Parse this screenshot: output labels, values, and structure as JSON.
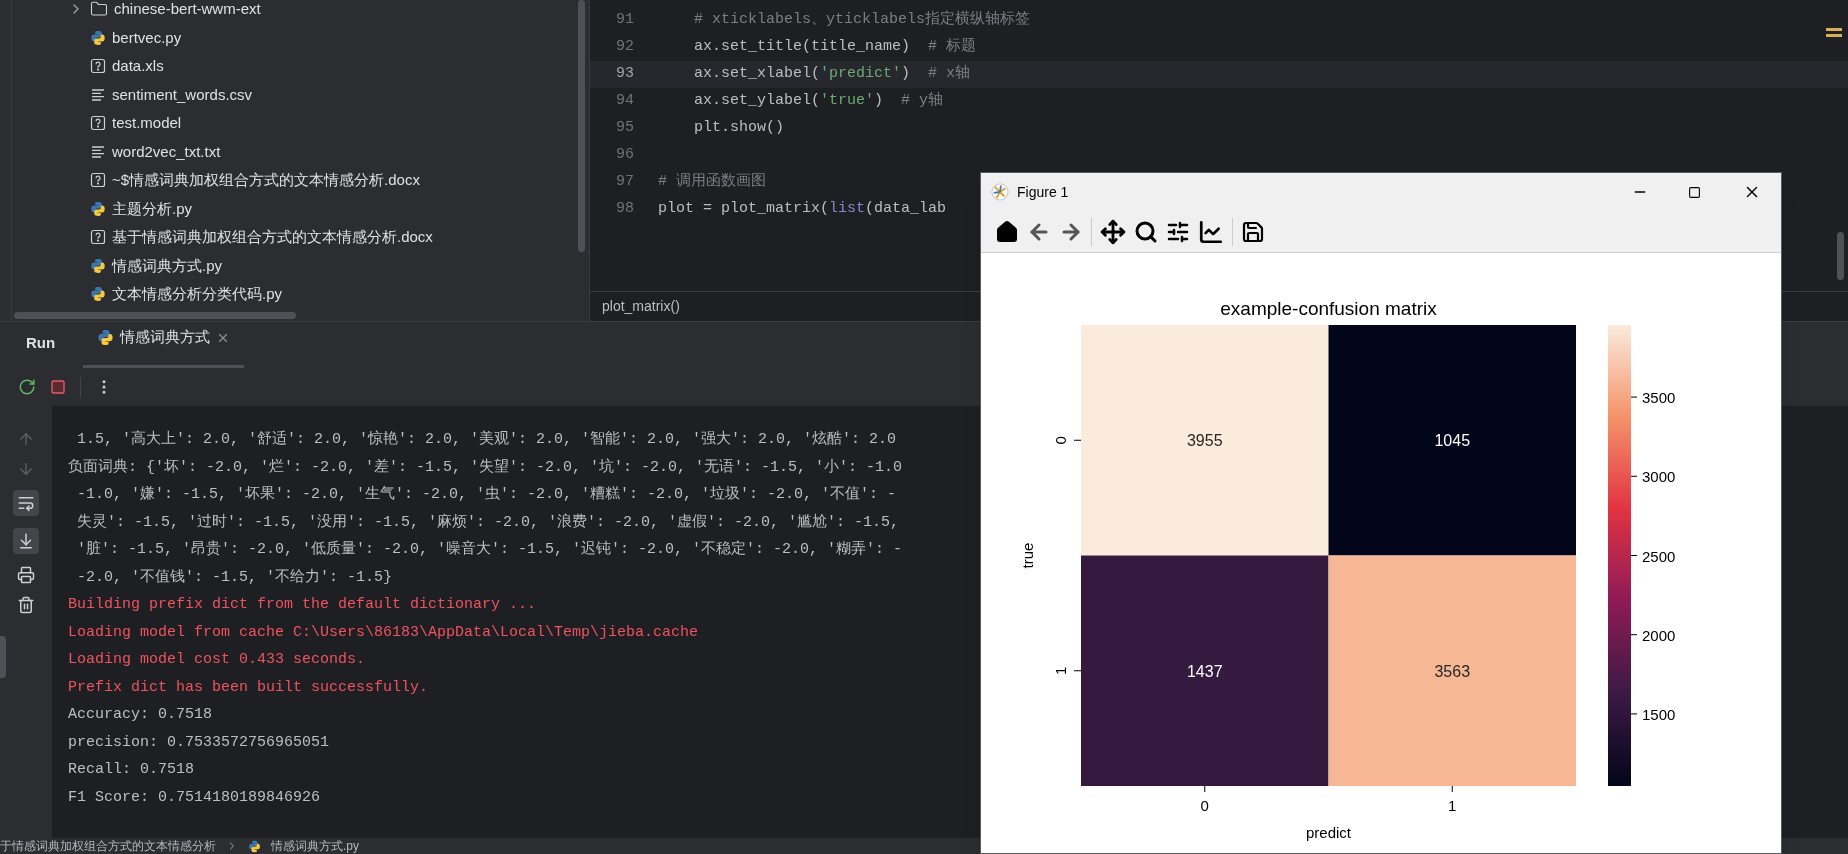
{
  "project_tree": {
    "items": [
      {
        "label": "chinese-bert-wwm-ext",
        "kind": "folder"
      },
      {
        "label": "bertvec.py",
        "kind": "python"
      },
      {
        "label": "data.xls",
        "kind": "unknown"
      },
      {
        "label": "sentiment_words.csv",
        "kind": "text"
      },
      {
        "label": "test.model",
        "kind": "unknown"
      },
      {
        "label": "word2vec_txt.txt",
        "kind": "text"
      },
      {
        "label": "~$情感词典加权组合方式的文本情感分析.docx",
        "kind": "unknown"
      },
      {
        "label": "主题分析.py",
        "kind": "python"
      },
      {
        "label": "基于情感词典加权组合方式的文本情感分析.docx",
        "kind": "unknown"
      },
      {
        "label": "情感词典方式.py",
        "kind": "python"
      },
      {
        "label": "文本情感分析分类代码.py",
        "kind": "python"
      }
    ]
  },
  "editor": {
    "lines": [
      {
        "number": "91",
        "current": false,
        "tokens": [
          {
            "text": "    # xticklabels、yticklabels指定横纵轴标签",
            "kind": "comment"
          }
        ]
      },
      {
        "number": "92",
        "current": false,
        "tokens": [
          {
            "text": "    ax.set_title(title_name)  ",
            "kind": "plain"
          },
          {
            "text": "# 标题",
            "kind": "comment"
          }
        ]
      },
      {
        "number": "93",
        "current": true,
        "tokens": [
          {
            "text": "    ax.set_xlabel(",
            "kind": "plain"
          },
          {
            "text": "'predict'",
            "kind": "string"
          },
          {
            "text": ")  ",
            "kind": "plain"
          },
          {
            "text": "# x轴",
            "kind": "comment"
          }
        ]
      },
      {
        "number": "94",
        "current": false,
        "tokens": [
          {
            "text": "    ax.set_ylabel(",
            "kind": "plain"
          },
          {
            "text": "'true'",
            "kind": "string"
          },
          {
            "text": ")  ",
            "kind": "plain"
          },
          {
            "text": "# y轴",
            "kind": "comment"
          }
        ]
      },
      {
        "number": "95",
        "current": false,
        "tokens": [
          {
            "text": "    plt.show()",
            "kind": "plain"
          }
        ]
      },
      {
        "number": "96",
        "current": false
      },
      {
        "number": "97",
        "current": false,
        "tokens": [
          {
            "text": "# 调用函数画图",
            "kind": "comment"
          }
        ]
      },
      {
        "number": "98",
        "current": false,
        "tokens": [
          {
            "text": "plot = plot_matrix(",
            "kind": "plain"
          },
          {
            "text": "list",
            "kind": "builtin"
          },
          {
            "text": "(data_lab",
            "kind": "plain"
          }
        ]
      }
    ],
    "breadcrumb": "plot_matrix()"
  },
  "run_panel": {
    "title": "Run",
    "tabs": [
      {
        "label": "情感词典方式",
        "selected": true
      }
    ],
    "console_lines": [
      {
        "text": " 1.5, '高大上': 2.0, '舒适': 2.0, '惊艳': 2.0, '美观': 2.0, '智能': 2.0, '强大': 2.0, '炫酷': 2.0",
        "kind": "stdout"
      },
      {
        "text": "负面词典: {'坏': -2.0, '烂': -2.0, '差': -1.5, '失望': -2.0, '坑': -2.0, '无语': -1.5, '小': -1.0",
        "kind": "stdout"
      },
      {
        "text": " -1.0, '嫌': -1.5, '坏果': -2.0, '生气': -2.0, '虫': -2.0, '糟糕': -2.0, '垃圾': -2.0, '不值': -",
        "kind": "stdout"
      },
      {
        "text": " 失灵': -1.5, '过时': -1.5, '没用': -1.5, '麻烦': -2.0, '浪费': -2.0, '虚假': -2.0, '尴尬': -1.5,",
        "kind": "stdout"
      },
      {
        "text": " '脏': -1.5, '昂贵': -2.0, '低质量': -2.0, '噪音大': -1.5, '迟钝': -2.0, '不稳定': -2.0, '糊弄': -",
        "kind": "stdout"
      },
      {
        "text": " -2.0, '不值钱': -1.5, '不给力': -1.5}",
        "kind": "stdout"
      },
      {
        "text": "Building prefix dict from the default dictionary ...",
        "kind": "stderr"
      },
      {
        "text": "Loading model from cache C:\\Users\\86183\\AppData\\Local\\Temp\\jieba.cache",
        "kind": "stderr"
      },
      {
        "text": "Loading model cost 0.433 seconds.",
        "kind": "stderr"
      },
      {
        "text": "Prefix dict has been built successfully.",
        "kind": "stderr"
      },
      {
        "text": "Accuracy: 0.7518",
        "kind": "stdout"
      },
      {
        "text": "precision: 0.7533572756965051",
        "kind": "stdout"
      },
      {
        "text": "Recall: 0.7518",
        "kind": "stdout"
      },
      {
        "text": "F1 Score: 0.7514180189846926",
        "kind": "stdout"
      }
    ]
  },
  "status_bar": {
    "breadcrumb": [
      "于情感词典加权组合方式的文本情感分析",
      "情感词典方式.py"
    ]
  },
  "figure_window": {
    "title": "Figure 1",
    "plot": {
      "title": "example-confusion matrix",
      "xlabel": "predict",
      "ylabel": "true",
      "xticks": [
        "0",
        "1"
      ],
      "yticks": [
        "0",
        "1"
      ],
      "cells": [
        {
          "value": "3955",
          "color": "#faebdd"
        },
        {
          "value": "1045",
          "color": "#03051a"
        },
        {
          "value": "1437",
          "color": "#35193e"
        },
        {
          "value": "3563",
          "color": "#f5b794"
        }
      ],
      "colorbar_ticks": [
        "3500",
        "3000",
        "2500",
        "2000",
        "1500"
      ]
    }
  }
}
